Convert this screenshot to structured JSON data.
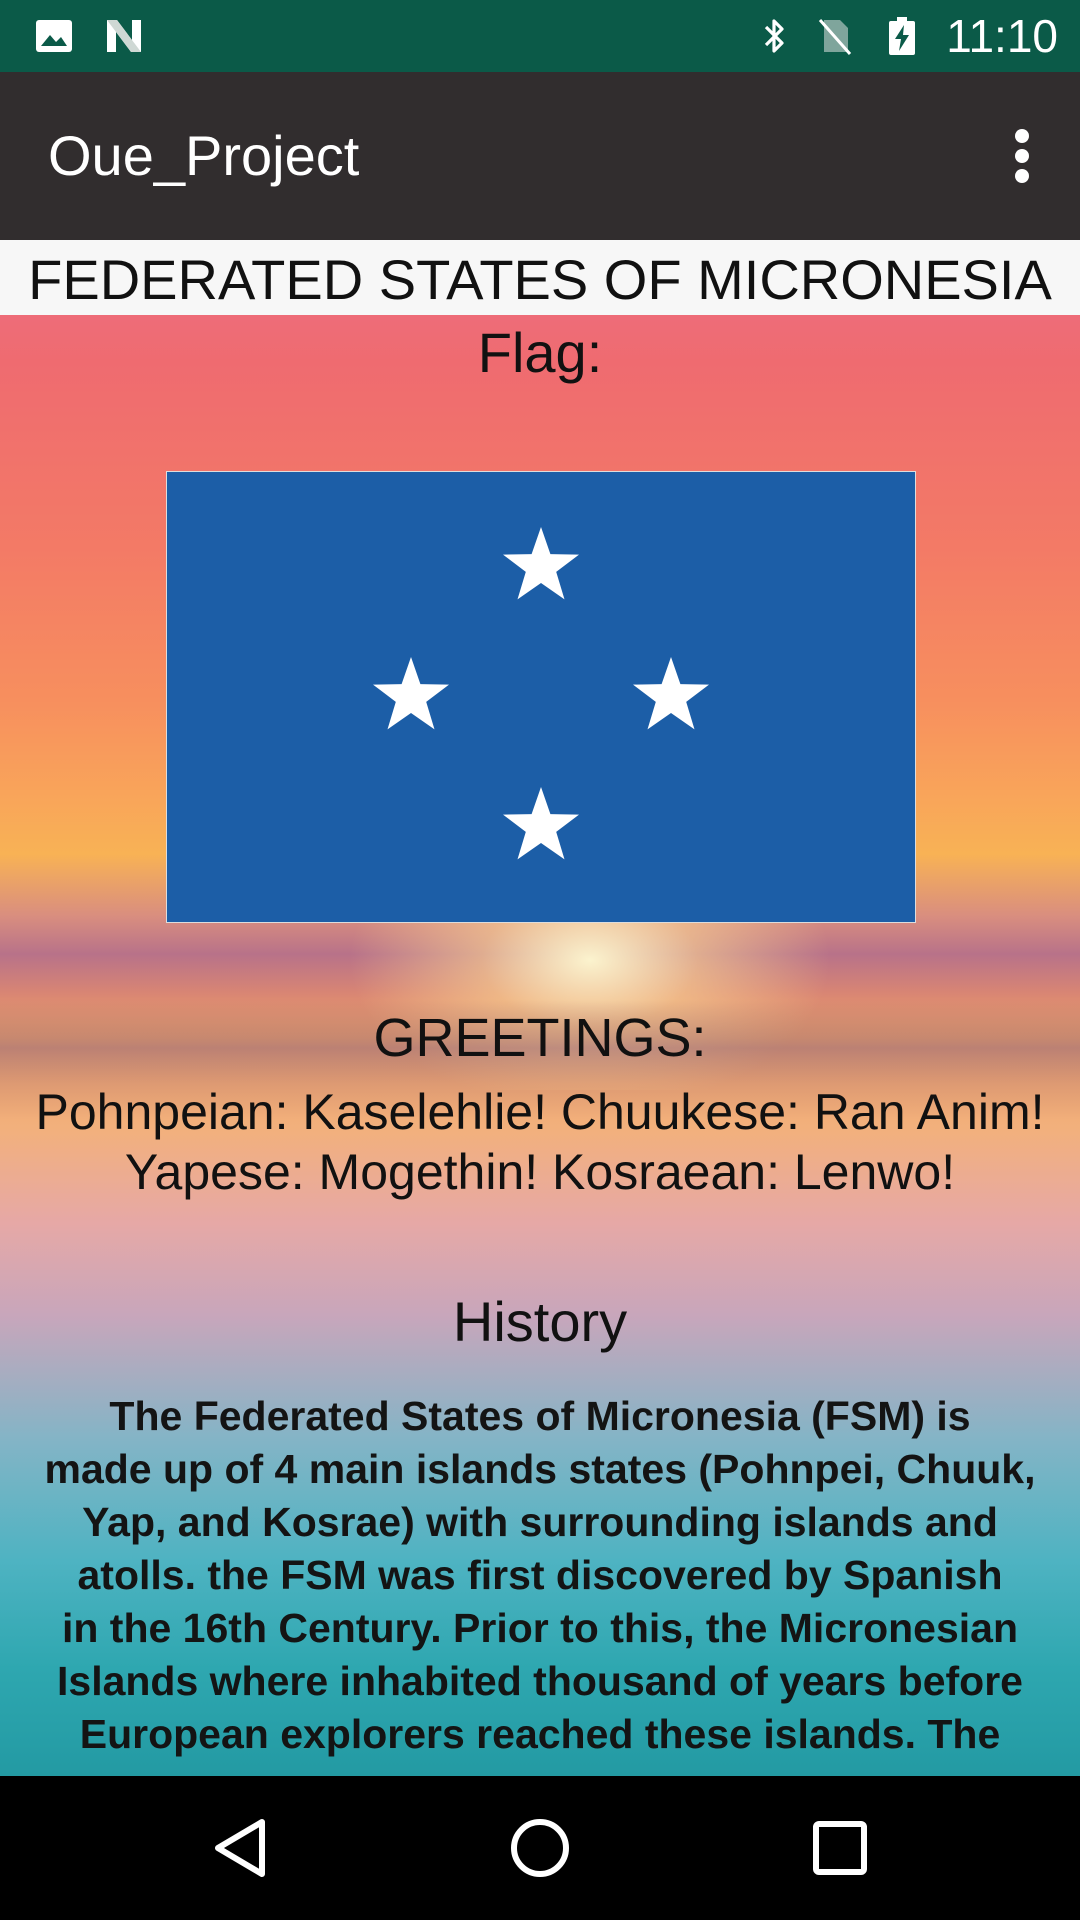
{
  "status_bar": {
    "time": "11:10",
    "icons": [
      "image-icon",
      "n-logo-icon",
      "bluetooth-icon",
      "no-sim-icon",
      "battery-charging-icon"
    ]
  },
  "app_bar": {
    "title": "Oue_Project",
    "overflow_icon": "more-vertical-icon"
  },
  "content": {
    "country_name": "FEDERATED STATES OF MICRONESIA",
    "flag_label": "Flag:",
    "flag": {
      "background": "#1c5ea7",
      "star_color": "#ffffff",
      "star_count": 4
    },
    "greetings_title": "GREETINGS:",
    "greetings_lines": [
      "Pohnpeian: Kaselehlie! Chuukese: Ran Anim!",
      "Yapese: Mogethin! Kosraean: Lenwo!"
    ],
    "history_title": "History",
    "history_lines": [
      "The Federated States of Micronesia (FSM) is",
      "made up of 4 main islands states (Pohnpei, Chuuk,",
      "Yap, and Kosrae) with surrounding islands and",
      "atolls. the FSM was first discovered by Spanish",
      "in the 16th Century. Prior to this, the Micronesian",
      "Islands where inhabited thousand of years before",
      "European explorers reached these islands. The"
    ]
  },
  "nav_bar": {
    "back_icon": "back-triangle-icon",
    "home_icon": "home-circle-icon",
    "recents_icon": "recents-square-icon"
  },
  "colors": {
    "status_bar": "#0b5a48",
    "app_bar": "#312d2e",
    "nav_bar": "#000000"
  }
}
